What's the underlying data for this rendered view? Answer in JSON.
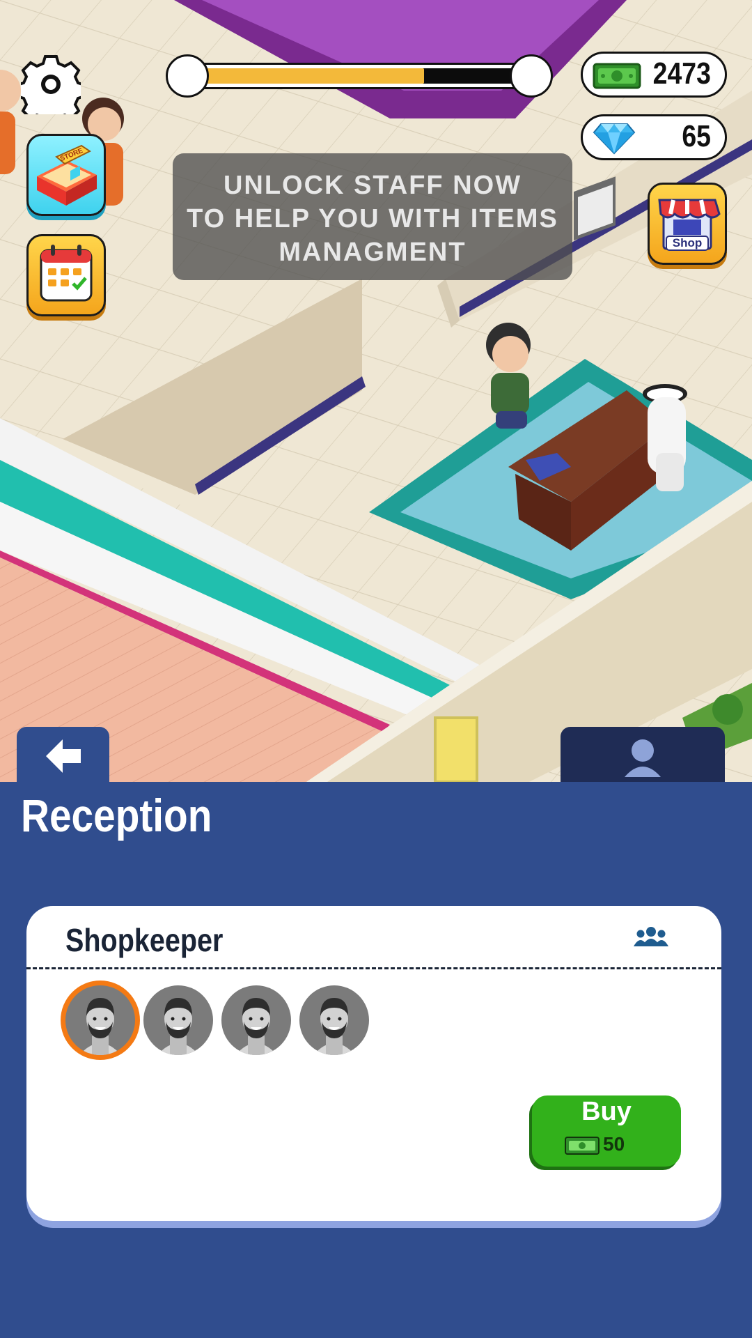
{
  "hud": {
    "cash": "2473",
    "gems": "65",
    "level_progress": 0.69,
    "shop_label": "Shop",
    "store_sign": "STORE"
  },
  "tooltip": {
    "line1": "UNLOCK STAFF NOW",
    "line2": "TO HELP YOU WITH ITEMS",
    "line3": "MANAGMENT"
  },
  "panel": {
    "title": "Reception",
    "card": {
      "title": "Shopkeeper",
      "avatar_count": 4,
      "selected_index": 0,
      "buy_label": "Buy",
      "price": "50"
    }
  },
  "colors": {
    "panel_bg": "#304d8e",
    "progress_fill": "#f3b93a",
    "buy_green": "#32b11b",
    "selected_ring": "#f47a14"
  },
  "icons": [
    "gear-icon",
    "cash-icon",
    "gem-icon",
    "store-icon",
    "calendar-icon",
    "shop-icon",
    "back-arrow-icon",
    "person-icon",
    "group-icon"
  ]
}
